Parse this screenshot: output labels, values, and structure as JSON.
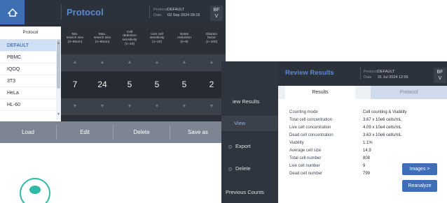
{
  "colors": {
    "accent": "#3d6fb6",
    "title_blue": "#5b8ad0",
    "dark_panel": "#2a2f38",
    "selection": "#cfe0f5",
    "teal_decoration": "#2fb9a7"
  },
  "protocol_screen": {
    "title": "Protocol",
    "meta": {
      "protocol_label": "Protocol",
      "protocol_value": "DEFAULT",
      "date_label": "Date",
      "date_value": "03 Sep 2024 09:16"
    },
    "user_chip": {
      "line1": "BF",
      "line2": "V"
    },
    "home_icon": "home-icon",
    "list": {
      "header": "Protocol",
      "items": [
        "DEFAULT",
        "PBMC",
        "IQOQ",
        "3T3",
        "HeLa",
        "HL-60"
      ]
    },
    "params": [
      {
        "label_l1": "Min.",
        "label_l2": "search size",
        "label_l3": "(3~59um)",
        "value": "7"
      },
      {
        "label_l1": "Max.",
        "label_l2": "search size",
        "label_l3": "(4~60um)",
        "value": "24"
      },
      {
        "label_l1": "Cell",
        "label_l2": "detection sensitivity",
        "label_l3": "(1~10)",
        "value": "5"
      },
      {
        "label_l1": "Live cell",
        "label_l2": "sensitivity",
        "label_l3": "(1~10)",
        "value": "5"
      },
      {
        "label_l1": "Noise",
        "label_l2": "reduction",
        "label_l3": "(0~9)",
        "value": "5"
      },
      {
        "label_l1": "Dilution",
        "label_l2": "factor",
        "label_l3": "(1~100)",
        "value": "2"
      }
    ],
    "buttons": {
      "load": "Load",
      "edit": "Edit",
      "delete": "Delete",
      "save_as": "Save as"
    }
  },
  "review_screen": {
    "title": "Review Results",
    "meta": {
      "protocol_label": "Protocol",
      "protocol_value": "DEFAULT",
      "date_label": "Date",
      "date_value": "31 Jul 2024 12:55"
    },
    "user_chip": {
      "line1": "BF",
      "line2": "V"
    },
    "sidebar": {
      "review_results": "iew Results",
      "view": "View",
      "export": "Export",
      "delete": "Delete",
      "previous_counts": "Previous Counts"
    },
    "tabs": {
      "results": "Results",
      "protocol": "Protocol"
    },
    "results": [
      {
        "label": "Counting mode",
        "value": "Cell counting & Viability"
      },
      {
        "label": "Total cell concentration",
        "value": "3.67 x 10e6 cells/mL"
      },
      {
        "label": "Live cell concentration",
        "value": "4.09 x 10e4 cells/mL"
      },
      {
        "label": "Dead cell concentration",
        "value": "3.63 x 10e6 cells/mL"
      },
      {
        "label": "Viability",
        "value": "1.1%"
      },
      {
        "label": "Average cell size",
        "value": "14.9"
      },
      {
        "label": "Total cell number",
        "value": "808"
      },
      {
        "label": "Live cell number",
        "value": "9"
      },
      {
        "label": "Dead cell number",
        "value": "799"
      }
    ],
    "buttons": {
      "images": "Images >",
      "reanalyze": "Reanalyze"
    }
  }
}
